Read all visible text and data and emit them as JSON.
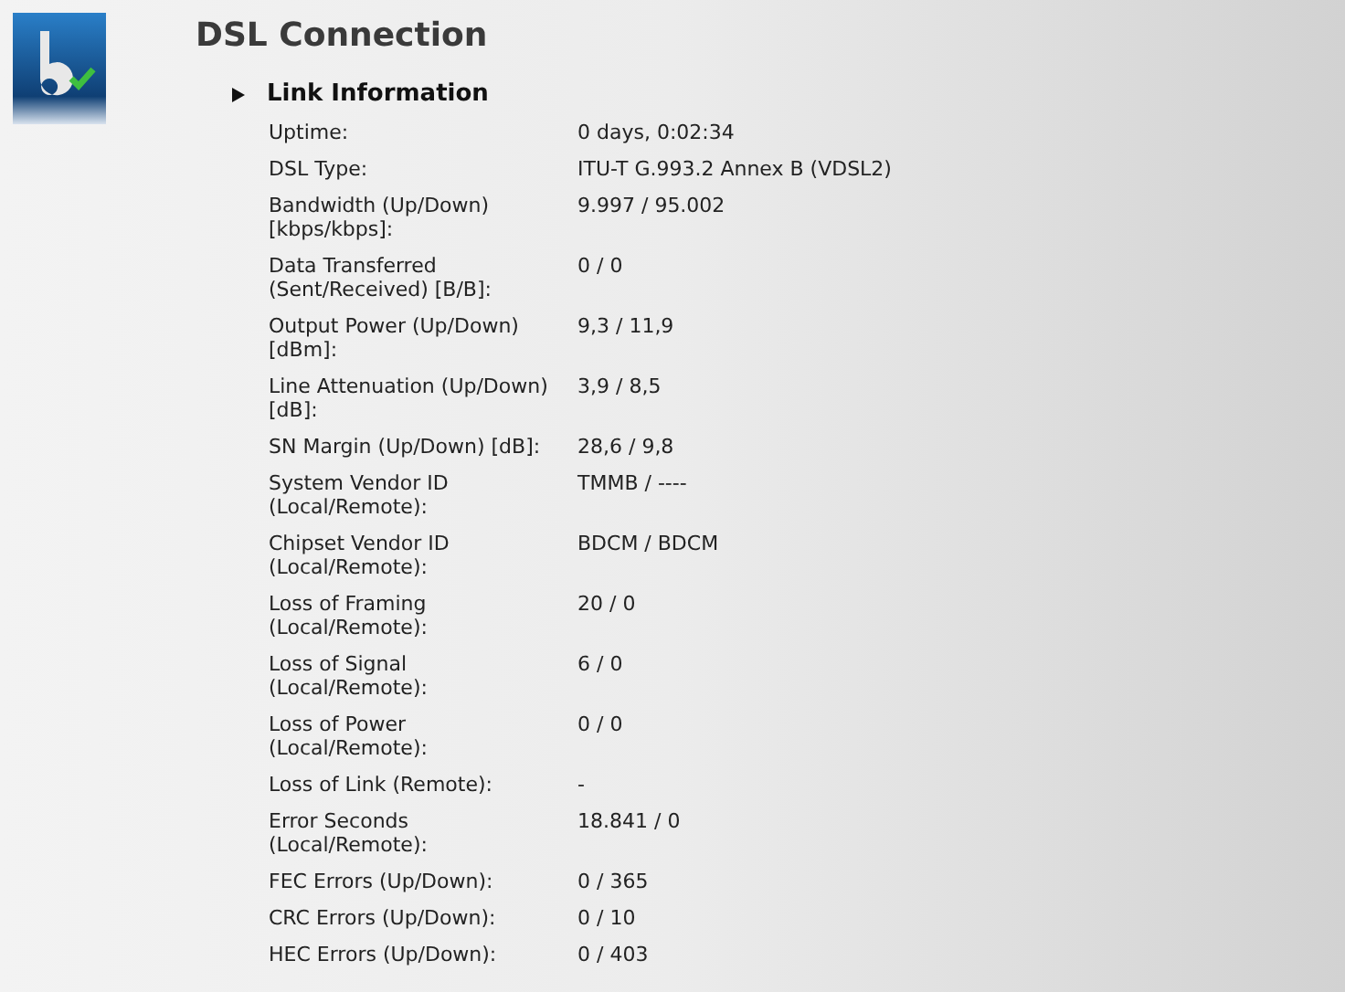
{
  "title": "DSL Connection",
  "section": {
    "title": "Link Information",
    "expanded": false,
    "rows": [
      {
        "label": "Uptime:",
        "value": "0 days, 0:02:34"
      },
      {
        "label": "DSL Type:",
        "value": "ITU-T G.993.2 Annex B (VDSL2)"
      },
      {
        "label": "Bandwidth (Up/Down)\n[kbps/kbps]:",
        "value": "9.997 / 95.002"
      },
      {
        "label": "Data Transferred\n(Sent/Received) [B/B]:",
        "value": "0 / 0"
      },
      {
        "label": "Output Power (Up/Down)\n[dBm]:",
        "value": "9,3 / 11,9"
      },
      {
        "label": "Line Attenuation (Up/Down)\n[dB]:",
        "value": "3,9 / 8,5"
      },
      {
        "label": "SN Margin (Up/Down) [dB]:",
        "value": "28,6 / 9,8"
      },
      {
        "label": "System Vendor ID\n(Local/Remote):",
        "value": "TMMB / ----"
      },
      {
        "label": "Chipset Vendor ID\n(Local/Remote):",
        "value": "BDCM / BDCM"
      },
      {
        "label": "Loss of Framing\n(Local/Remote):",
        "value": "20 / 0"
      },
      {
        "label": "Loss of Signal\n(Local/Remote):",
        "value": "6 / 0"
      },
      {
        "label": "Loss of Power\n(Local/Remote):",
        "value": "0 / 0"
      },
      {
        "label": "Loss of Link (Remote):",
        "value": "-"
      },
      {
        "label": "Error Seconds\n(Local/Remote):",
        "value": "18.841 / 0"
      },
      {
        "label": "FEC Errors (Up/Down):",
        "value": "0 / 365"
      },
      {
        "label": "CRC Errors (Up/Down):",
        "value": "0 / 10"
      },
      {
        "label": "HEC Errors (Up/Down):",
        "value": "0 / 403"
      }
    ]
  }
}
